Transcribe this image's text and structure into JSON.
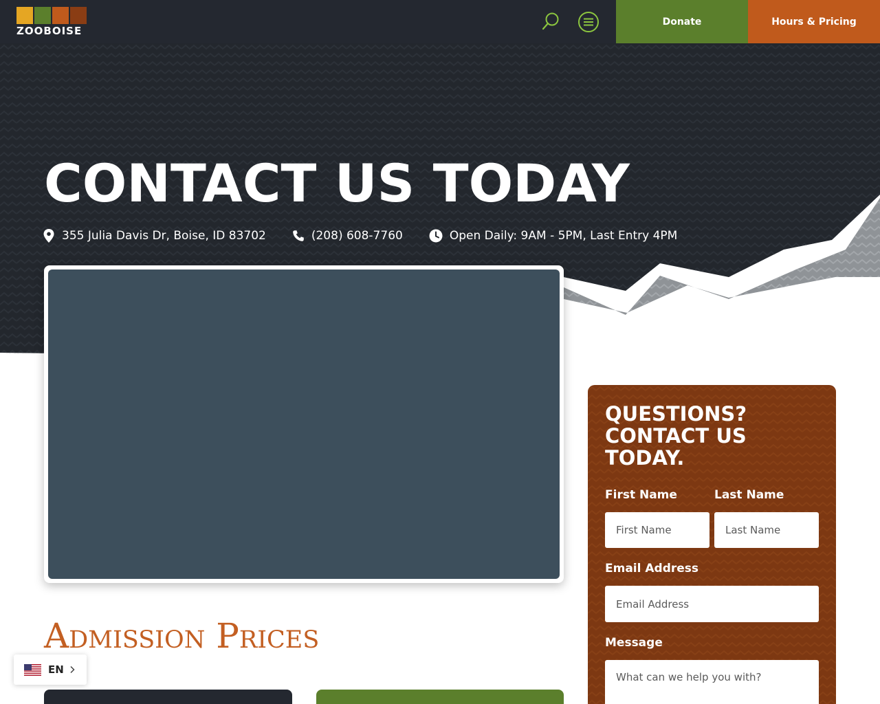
{
  "header": {
    "logo_text": "ZOOBOISE",
    "search_icon": "search-icon",
    "menu_icon": "hamburger-menu-icon",
    "donate_label": "Donate",
    "hours_label": "Hours & Pricing"
  },
  "hero": {
    "title": "CONTACT US TODAY",
    "address": "355 Julia Davis Dr, Boise, ID 83702",
    "phone": "(208) 608-7760",
    "hours": "Open Daily: 9AM - 5PM, Last Entry 4PM"
  },
  "admission": {
    "heading": "Admission Prices"
  },
  "contact_form": {
    "title": "QUESTIONS?\nCONTACT US\nTODAY.",
    "first_name_label": "First Name",
    "first_name_placeholder": "First Name",
    "last_name_label": "Last Name",
    "last_name_placeholder": "Last Name",
    "email_label": "Email Address",
    "email_placeholder": "Email Address",
    "message_label": "Message",
    "message_placeholder": "What can we help you with?"
  },
  "language": {
    "code": "EN",
    "flag_icon": "us-flag-icon"
  },
  "colors": {
    "header_bg": "#242830",
    "donate": "#5b7f2c",
    "hours": "#c05a1c",
    "form_bg": "#7d3812",
    "admission_heading": "#c35f22",
    "map_placeholder": "#3d4f5c"
  }
}
